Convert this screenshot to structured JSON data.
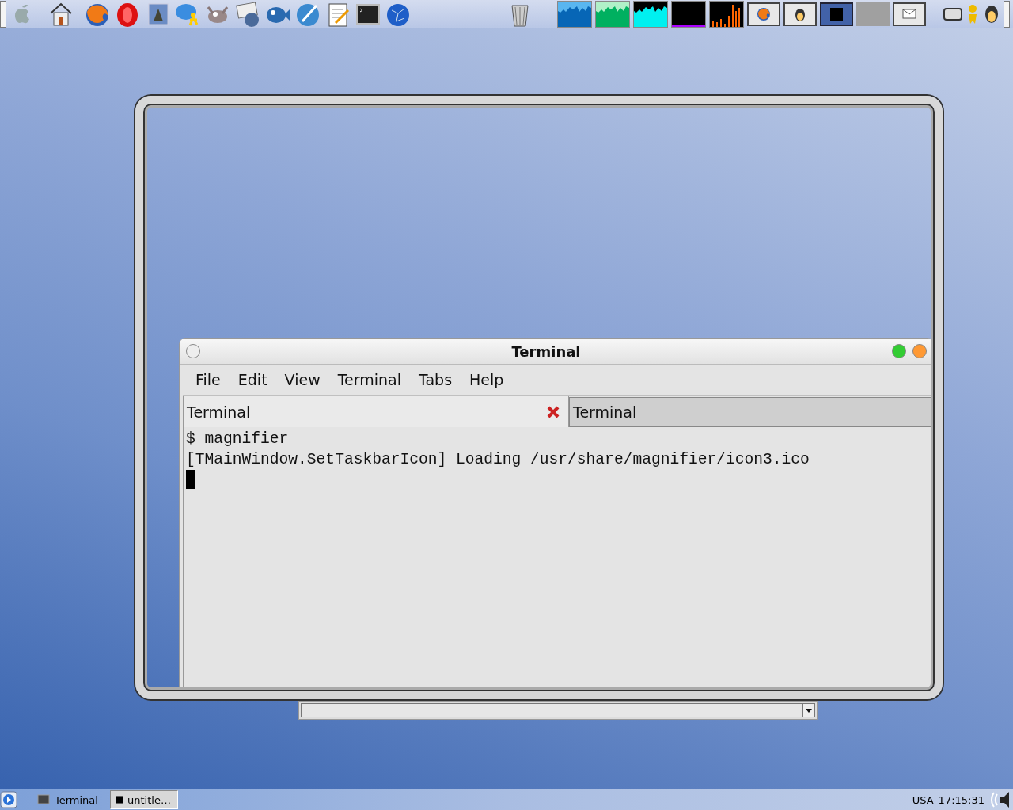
{
  "terminal_window": {
    "title": "Terminal",
    "menu": [
      "File",
      "Edit",
      "View",
      "Terminal",
      "Tabs",
      "Help"
    ],
    "tabs": [
      {
        "label": "Terminal",
        "selected": true
      },
      {
        "label": "Terminal",
        "selected": false
      }
    ],
    "lines": [
      "$ magnifier",
      "[TMainWindow.SetTaskbarIcon] Loading /usr/share/magnifier/icon3.ico"
    ]
  },
  "taskbar": {
    "tasks": [
      {
        "label": "Terminal",
        "selected": false
      },
      {
        "label": "untitle…",
        "selected": true
      }
    ],
    "keyboard_layout": "USA",
    "clock": "17:15:31"
  }
}
